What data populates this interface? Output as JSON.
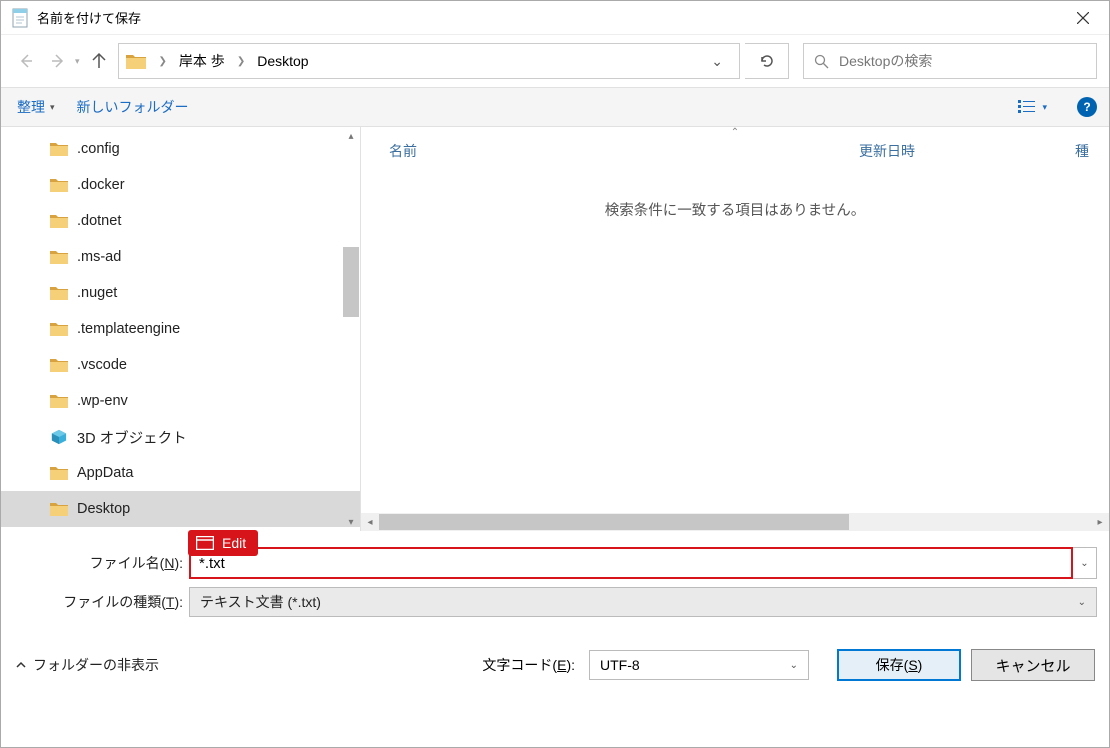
{
  "title": "名前を付けて保存",
  "breadcrumb": {
    "part1": "岸本 歩",
    "part2": "Desktop"
  },
  "search": {
    "placeholder": "Desktopの検索"
  },
  "toolbar": {
    "organize": "整理",
    "new_folder": "新しいフォルダー"
  },
  "columns": {
    "name": "名前",
    "date": "更新日時",
    "type": "種"
  },
  "empty_message": "検索条件に一致する項目はありません。",
  "tree": {
    "items": [
      {
        "label": ".config",
        "icon": "folder"
      },
      {
        "label": ".docker",
        "icon": "folder"
      },
      {
        "label": ".dotnet",
        "icon": "folder"
      },
      {
        "label": ".ms-ad",
        "icon": "folder"
      },
      {
        "label": ".nuget",
        "icon": "folder"
      },
      {
        "label": ".templateengine",
        "icon": "folder"
      },
      {
        "label": ".vscode",
        "icon": "folder"
      },
      {
        "label": ".wp-env",
        "icon": "folder"
      },
      {
        "label": "3D オブジェクト",
        "icon": "3d"
      },
      {
        "label": "AppData",
        "icon": "folder"
      },
      {
        "label": "Desktop",
        "icon": "folder",
        "selected": true
      }
    ]
  },
  "edit_badge": "Edit",
  "form": {
    "filename_label_pre": "ファイル名(",
    "filename_label_key": "N",
    "filename_label_post": "):",
    "filename_value": "*.txt",
    "filetype_label_pre": "ファイルの種類(",
    "filetype_label_key": "T",
    "filetype_label_post": "):",
    "filetype_value": "テキスト文書 (*.txt)"
  },
  "footer": {
    "folder_hide": "フォルダーの非表示",
    "encoding_label_pre": "文字コード(",
    "encoding_label_key": "E",
    "encoding_label_post": "):",
    "encoding_value": "UTF-8",
    "save_pre": "保存(",
    "save_key": "S",
    "save_post": ")",
    "cancel": "キャンセル"
  }
}
